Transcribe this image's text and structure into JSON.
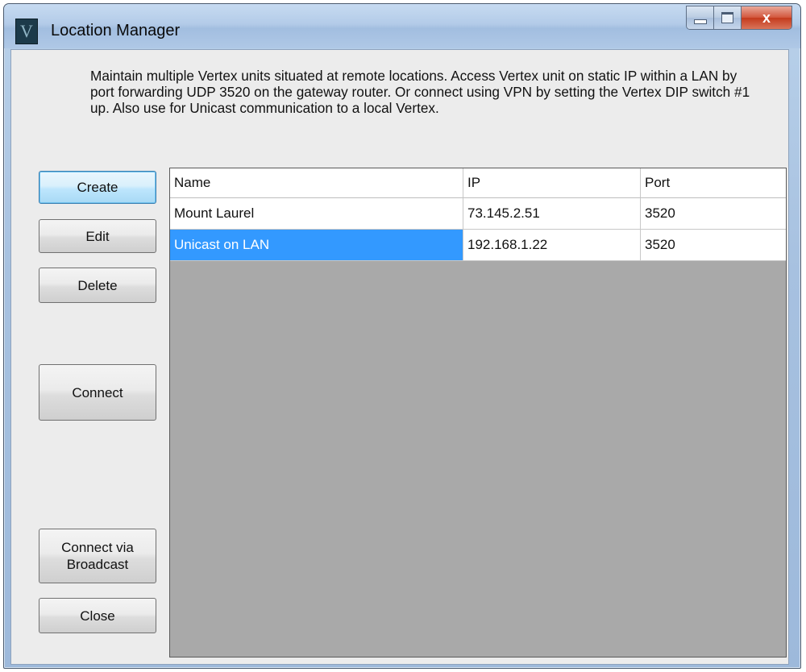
{
  "window": {
    "title": "Location Manager",
    "icon_letter": "V"
  },
  "caption": {
    "close_label": "x"
  },
  "description": "Maintain multiple Vertex units situated at remote locations.  Access Vertex unit on static IP within a LAN by port forwarding UDP 3520 on the gateway router.  Or connect using VPN by setting the Vertex DIP switch #1 up.  Also use for Unicast communication to a local Vertex.",
  "buttons": {
    "create": "Create",
    "edit": "Edit",
    "delete": "Delete",
    "connect": "Connect",
    "connect_broadcast_line1": "Connect via",
    "connect_broadcast_line2": "Broadcast",
    "close": "Close"
  },
  "table": {
    "columns": [
      "Name",
      "IP",
      "Port"
    ],
    "rows": [
      {
        "name": "Mount Laurel",
        "ip": "73.145.2.51",
        "port": "3520",
        "selected": false
      },
      {
        "name": "Unicast on LAN",
        "ip": "192.168.1.22",
        "port": "3520",
        "selected": true
      }
    ]
  },
  "colors": {
    "selection": "#3399ff",
    "grid_empty": "#a9a9a9",
    "close_button": "#c43a1c"
  }
}
